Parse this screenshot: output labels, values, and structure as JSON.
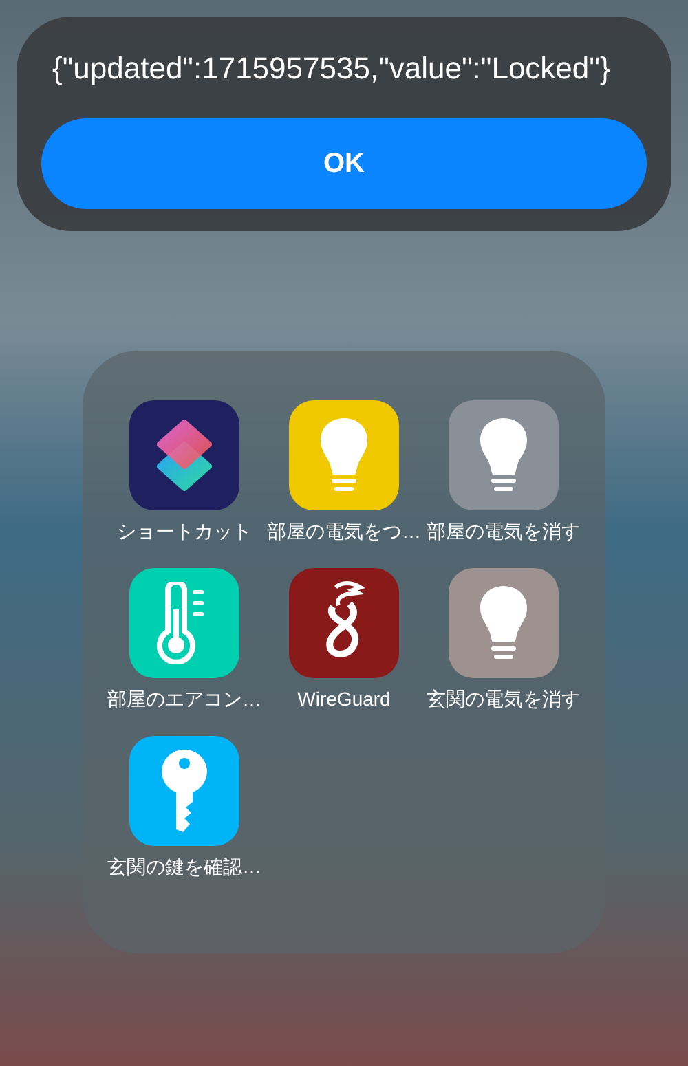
{
  "alert": {
    "message": "{\"updated\":1715957535,\"value\":\"Locked\"}",
    "button": "OK"
  },
  "folder": {
    "apps": [
      {
        "label": "ショートカット",
        "kind": "shortcuts",
        "color": "#1e2060"
      },
      {
        "label": "部屋の電気をつ…",
        "kind": "bulb",
        "color": "#f0c800"
      },
      {
        "label": "部屋の電気を消す",
        "kind": "bulb",
        "color": "#8a9098"
      },
      {
        "label": "部屋のエアコン…",
        "kind": "thermometer",
        "color": "#00d0b0"
      },
      {
        "label": "WireGuard",
        "kind": "wireguard",
        "color": "#8a1a1a"
      },
      {
        "label": "玄関の電気を消す",
        "kind": "bulb",
        "color": "#9e9290"
      },
      {
        "label": "玄関の鍵を確認…",
        "kind": "key",
        "color": "#00b4f8"
      }
    ]
  }
}
